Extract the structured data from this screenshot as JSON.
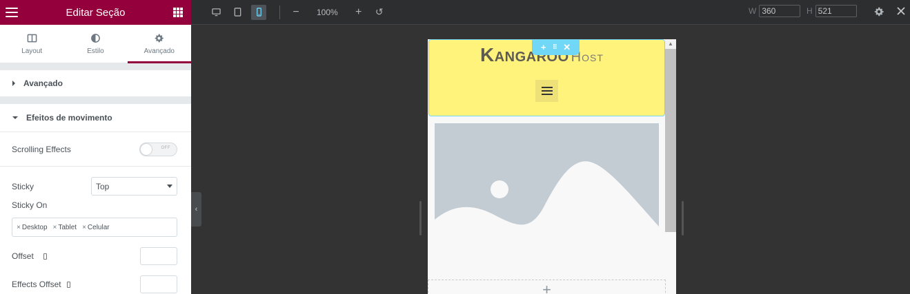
{
  "panel": {
    "title": "Editar Seção",
    "tabs": [
      {
        "label": "Layout"
      },
      {
        "label": "Estilo"
      },
      {
        "label": "Avançado"
      }
    ],
    "active_tab": "Avançado",
    "sections": {
      "advanced": "Avançado",
      "motion": "Efeitos de movimento"
    },
    "scrolling_effects": {
      "label": "Scrolling Effects",
      "state": "OFF"
    },
    "sticky": {
      "label": "Sticky",
      "value": "Top"
    },
    "sticky_on": {
      "label": "Sticky On",
      "chips": [
        "Desktop",
        "Tablet",
        "Celular"
      ]
    },
    "offset": {
      "label": "Offset"
    },
    "effects_offset": {
      "label": "Effects Offset"
    },
    "accent_color": "#93003c"
  },
  "topbar": {
    "devices": [
      "desktop",
      "tablet",
      "mobile"
    ],
    "active_device": "mobile",
    "zoom": "100%",
    "width_label": "W",
    "width_value": "360",
    "height_label": "H",
    "height_value": "521"
  },
  "preview": {
    "logo_main": "Kangaroo",
    "logo_sub": "Host",
    "header_bg": "#fff37c",
    "handle_color": "#71d7f7"
  }
}
